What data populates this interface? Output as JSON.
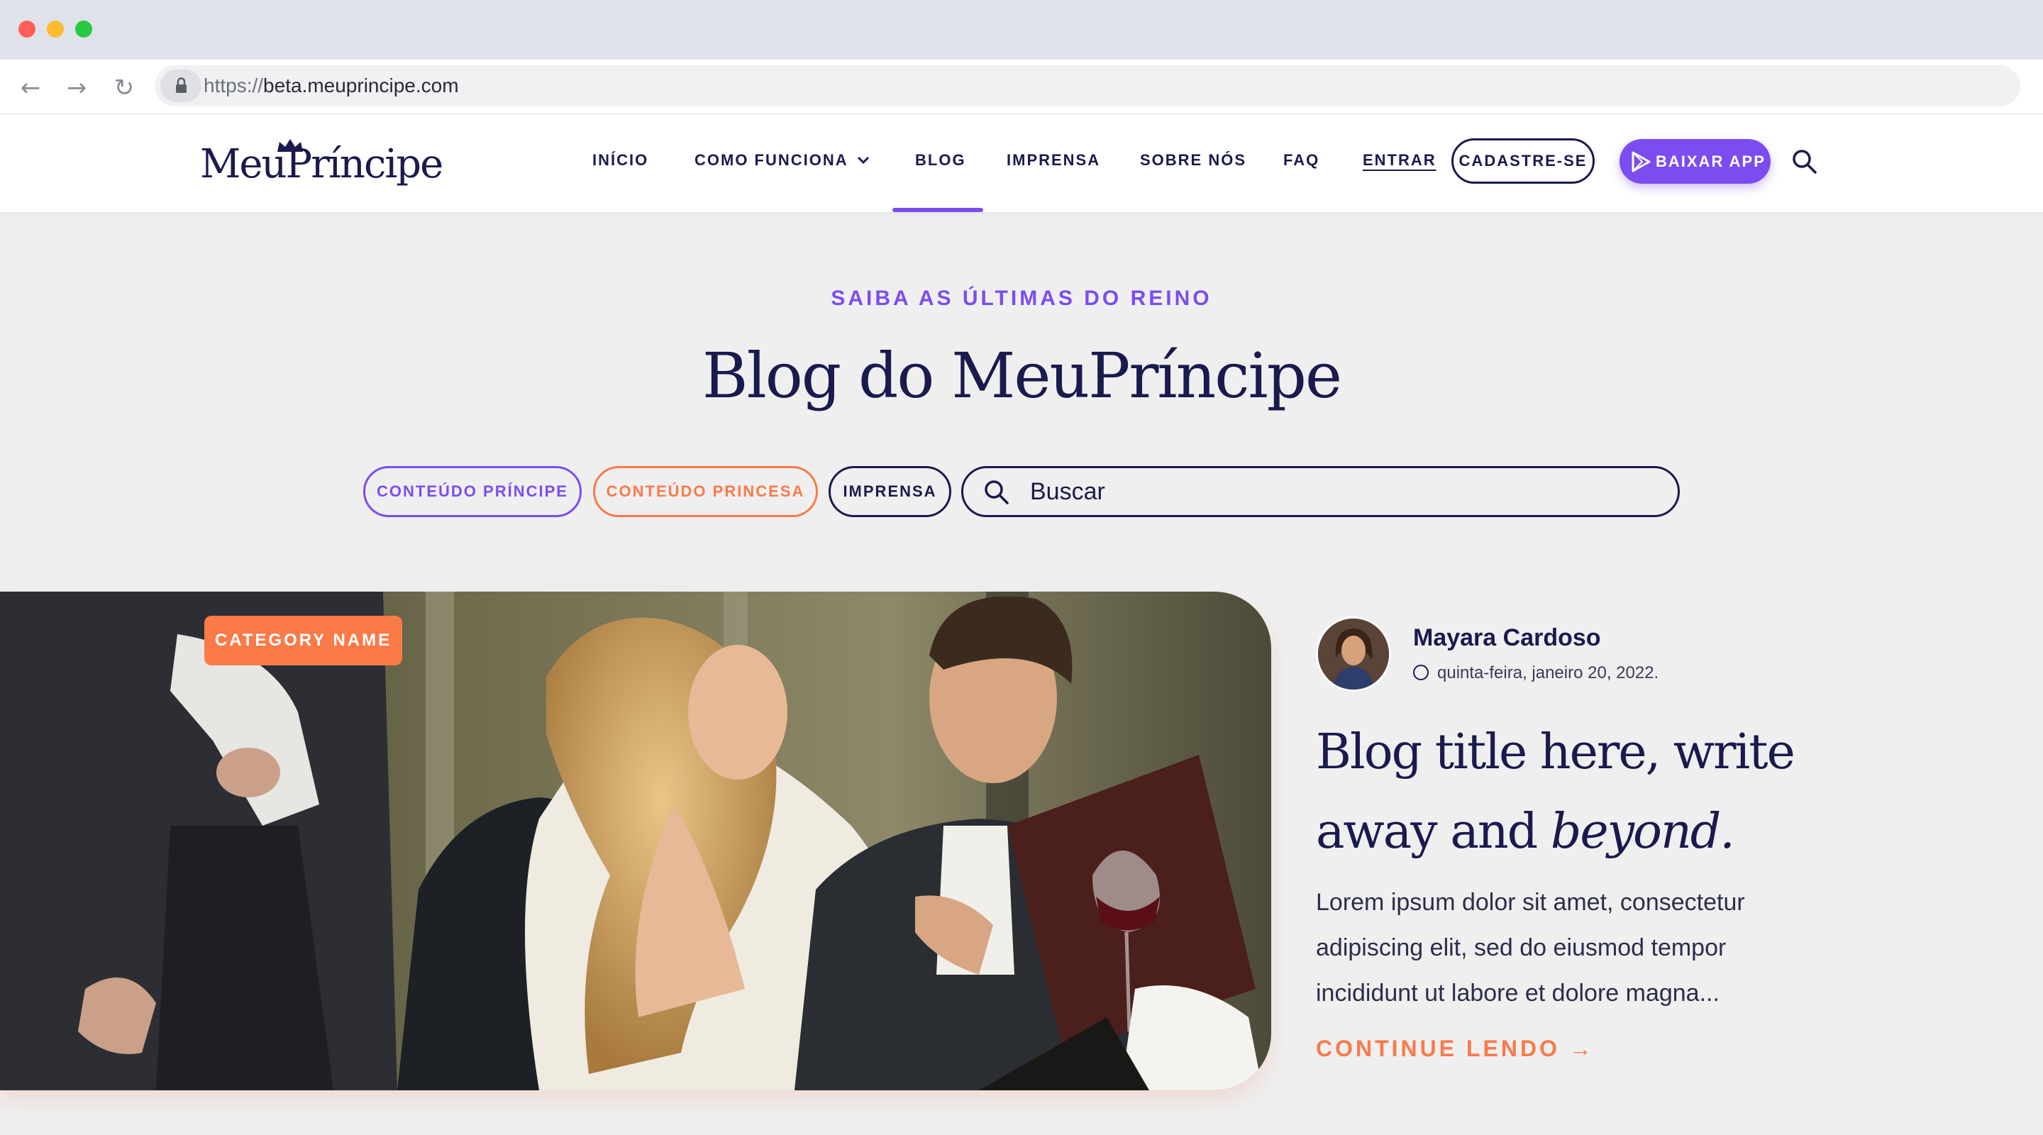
{
  "browser": {
    "url_scheme": "https://",
    "url_host": "beta.meuprincipe.com",
    "traffic_light_colors": [
      "#fe5f57",
      "#febc2e",
      "#28c840"
    ]
  },
  "header": {
    "logo_text": "MeuPríncipe",
    "nav": {
      "inicio": "INÍCIO",
      "como_funciona": "COMO FUNCIONA",
      "blog": "BLOG",
      "imprensa": "IMPRENSA",
      "sobre_nos": "SOBRE NÓS",
      "faq": "FAQ",
      "entrar": "ENTRAR"
    },
    "cadastre_label": "CADASTRE-SE",
    "app_label": "BAIXAR APP",
    "active_item": "BLOG"
  },
  "hero_section": {
    "eyebrow": "SAIBA AS ÚLTIMAS DO REINO",
    "title": "Blog do MeuPríncipe"
  },
  "filters": {
    "principe": "CONTEÚDO PRÍNCIPE",
    "princesa": "CONTEÚDO PRINCESA",
    "imprensa": "IMPRENSA",
    "search_placeholder": "Buscar"
  },
  "featured_post": {
    "category": "CATEGORY NAME",
    "author": "Mayara Cardoso",
    "date": "quinta-feira, janeiro 20, 2022.",
    "title_plain": "Blog title here, write away and ",
    "title_italic": "beyond.",
    "excerpt": "Lorem ipsum dolor sit amet, consectetur adipiscing elit, sed do eiusmod tempor incididunt ut labore et dolore magna...",
    "cta": "CONTINUE LENDO →"
  },
  "colors": {
    "navy": "#1b1a4e",
    "purple": "#7b4dee",
    "orange": "#fa7a48",
    "page_bg": "#efeff0"
  }
}
